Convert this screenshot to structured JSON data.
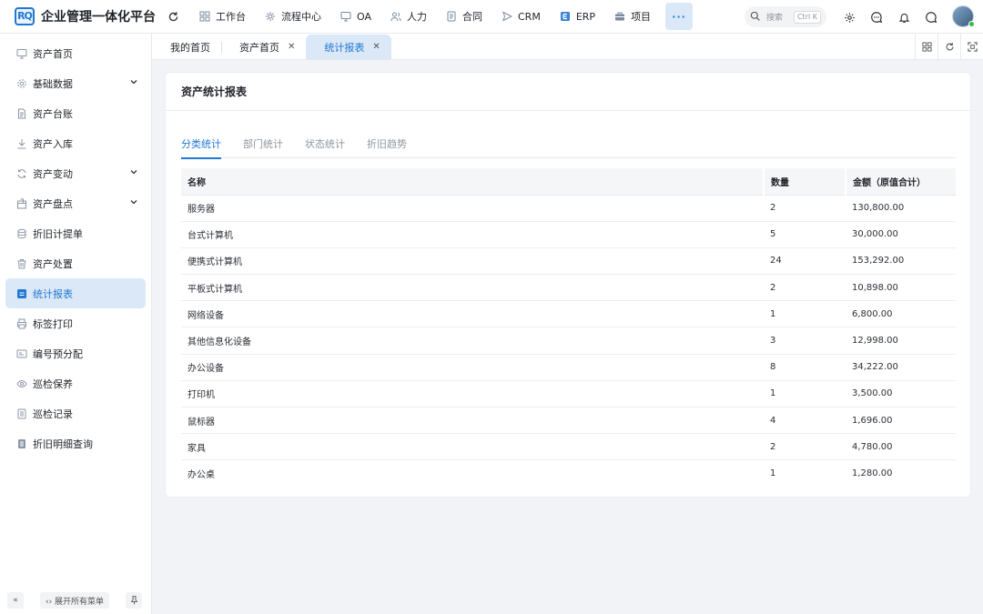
{
  "app": {
    "logo_mark": "RQ",
    "title": "企业管理一体化平台"
  },
  "topnav": [
    {
      "label": "工作台",
      "icon": "grid-icon"
    },
    {
      "label": "流程中心",
      "icon": "flow-icon"
    },
    {
      "label": "OA",
      "icon": "monitor-icon"
    },
    {
      "label": "人力",
      "icon": "people-icon"
    },
    {
      "label": "合同",
      "icon": "document-icon"
    },
    {
      "label": "CRM",
      "icon": "send-icon"
    },
    {
      "label": "ERP",
      "icon": "erp-icon"
    },
    {
      "label": "项目",
      "icon": "briefcase-icon"
    }
  ],
  "more_label": "···",
  "search": {
    "placeholder": "搜索",
    "shortcut": "Ctrl K"
  },
  "sidebar": {
    "items": [
      {
        "label": "资产首页",
        "icon": "monitor-icon",
        "expandable": false
      },
      {
        "label": "基础数据",
        "icon": "gear-icon",
        "expandable": true
      },
      {
        "label": "资产台账",
        "icon": "file-icon",
        "expandable": false
      },
      {
        "label": "资产入库",
        "icon": "download-icon",
        "expandable": false
      },
      {
        "label": "资产变动",
        "icon": "sync-icon",
        "expandable": true
      },
      {
        "label": "资产盘点",
        "icon": "package-icon",
        "expandable": true
      },
      {
        "label": "折旧计提单",
        "icon": "database-icon",
        "expandable": false
      },
      {
        "label": "资产处置",
        "icon": "trash-icon",
        "expandable": false
      },
      {
        "label": "统计报表",
        "icon": "report-icon",
        "expandable": false,
        "active": true
      },
      {
        "label": "标签打印",
        "icon": "printer-icon",
        "expandable": false
      },
      {
        "label": "编号预分配",
        "icon": "id-card-icon",
        "expandable": false
      },
      {
        "label": "巡检保养",
        "icon": "eye-icon",
        "expandable": false
      },
      {
        "label": "巡检记录",
        "icon": "list-icon",
        "expandable": false
      },
      {
        "label": "折旧明细查询",
        "icon": "ledger-icon",
        "expandable": false
      }
    ],
    "collapse_label": "«",
    "expand_all_label": "‹› 展开所有菜单"
  },
  "tabs": [
    {
      "label": "我的首页",
      "closable": false
    },
    {
      "label": "资产首页",
      "closable": true
    },
    {
      "label": "统计报表",
      "closable": true,
      "active": true
    }
  ],
  "page": {
    "title": "资产统计报表",
    "subtabs": [
      "分类统计",
      "部门统计",
      "状态统计",
      "折旧趋势"
    ],
    "active_subtab": 0,
    "table": {
      "headers": [
        "名称",
        "数量",
        "金额（原值合计）"
      ],
      "rows": [
        [
          "服务器",
          "2",
          "130,800.00"
        ],
        [
          "台式计算机",
          "5",
          "30,000.00"
        ],
        [
          "便携式计算机",
          "24",
          "153,292.00"
        ],
        [
          "平板式计算机",
          "2",
          "10,898.00"
        ],
        [
          "网络设备",
          "1",
          "6,800.00"
        ],
        [
          "其他信息化设备",
          "3",
          "12,998.00"
        ],
        [
          "办公设备",
          "8",
          "34,222.00"
        ],
        [
          "打印机",
          "1",
          "3,500.00"
        ],
        [
          "鼠标器",
          "4",
          "1,696.00"
        ],
        [
          "家具",
          "2",
          "4,780.00"
        ],
        [
          "办公桌",
          "1",
          "1,280.00"
        ]
      ]
    }
  },
  "colors": {
    "accent": "#1f78d1",
    "active_bg": "#dbe8f8",
    "online": "#2fbf4a"
  }
}
